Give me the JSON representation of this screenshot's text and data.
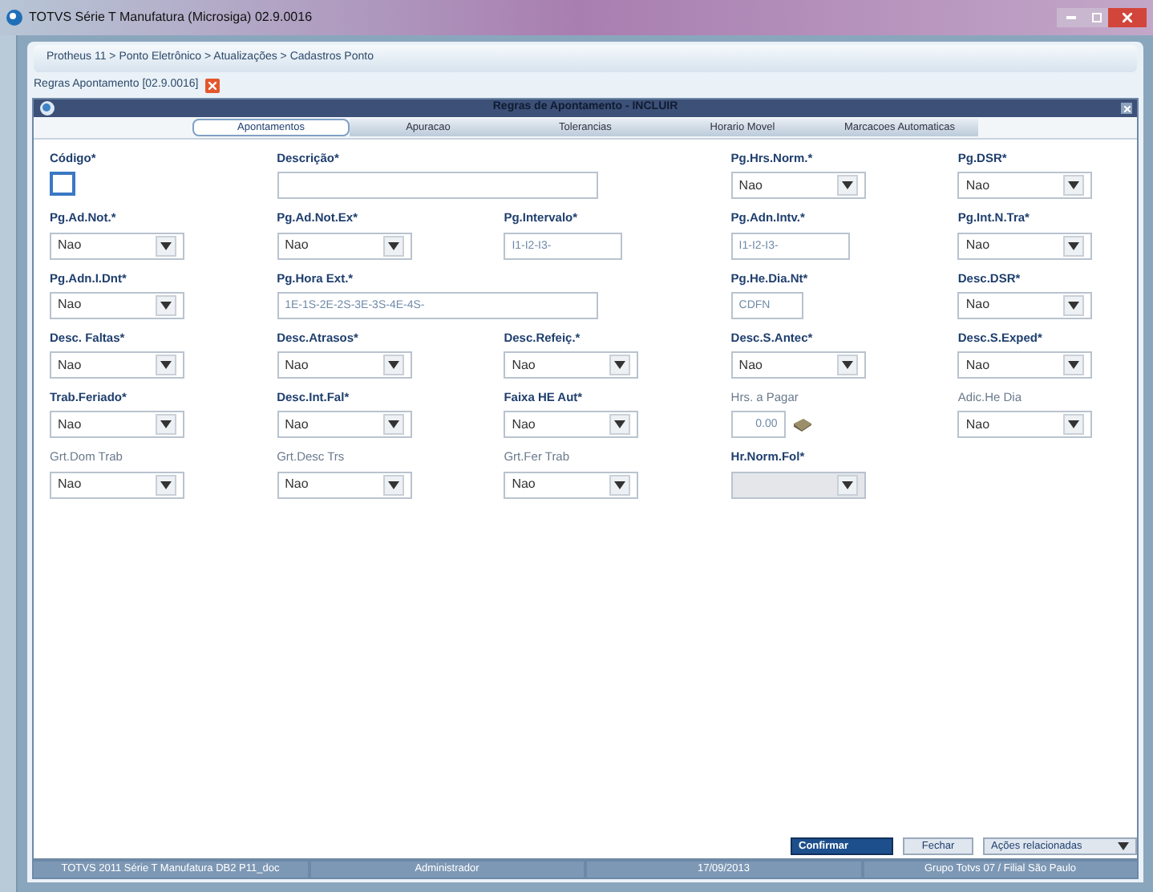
{
  "window": {
    "title": "TOTVS Série T Manufatura (Microsiga) 02.9.0016"
  },
  "breadcrumb": "Protheus 11 > Ponto Eletrônico > Atualizações > Cadastros Ponto",
  "document_tab": {
    "label": "Regras Apontamento [02.9.0016]"
  },
  "dialog": {
    "title": "Regras de Apontamento - INCLUIR"
  },
  "tabs": [
    {
      "label": "Apontamentos",
      "selected": true
    },
    {
      "label": "Apuracao",
      "selected": false
    },
    {
      "label": "Tolerancias",
      "selected": false
    },
    {
      "label": "Horario Movel",
      "selected": false
    },
    {
      "label": "Marcacoes Automaticas",
      "selected": false
    }
  ],
  "fields": [
    {
      "label": "Código*",
      "kind": "code",
      "required": true,
      "disabled": false
    },
    {
      "label": "Descrição*",
      "kind": "wide_text",
      "required": true,
      "disabled": false
    },
    {
      "label": "Pg.Hrs.Norm.*",
      "kind": "select",
      "value": "Nao",
      "required": true,
      "disabled": false
    },
    {
      "label": "Pg.DSR*",
      "kind": "select",
      "value": "Nao",
      "required": true,
      "disabled": false
    },
    {
      "label": "Pg.Ad.Not.*",
      "kind": "select",
      "value": "Nao",
      "required": true,
      "disabled": false
    },
    {
      "label": "Pg.Ad.Not.Ex*",
      "kind": "select",
      "value": "Nao",
      "required": true,
      "disabled": false
    },
    {
      "label": "Pg.Intervalo*",
      "kind": "text",
      "value": "I1-I2-I3-",
      "required": true,
      "disabled": false
    },
    {
      "label": "Pg.Adn.Intv.*",
      "kind": "text",
      "value": "I1-I2-I3-",
      "required": true,
      "disabled": false
    },
    {
      "label": "Pg.Int.N.Tra*",
      "kind": "select",
      "value": "Nao",
      "required": true,
      "disabled": false
    },
    {
      "label": "Pg.Adn.I.Dnt*",
      "kind": "select",
      "value": "Nao",
      "required": true,
      "disabled": false
    },
    {
      "label": "Pg.Hora Ext.*",
      "kind": "wide_text",
      "value": "1E-1S-2E-2S-3E-3S-4E-4S-",
      "required": true,
      "disabled": false
    },
    {
      "label": "Pg.He.Dia.Nt*",
      "kind": "short_text",
      "value": "CDFN",
      "required": true,
      "disabled": false
    },
    {
      "label": "Desc.DSR*",
      "kind": "select",
      "value": "Nao",
      "required": true,
      "disabled": false
    },
    {
      "label": "Desc. Faltas*",
      "kind": "select",
      "value": "Nao",
      "required": true,
      "disabled": false
    },
    {
      "label": "Desc.Atrasos*",
      "kind": "select",
      "value": "Nao",
      "required": true,
      "disabled": false
    },
    {
      "label": "Desc.Refeiç.*",
      "kind": "select",
      "value": "Nao",
      "required": true,
      "disabled": false
    },
    {
      "label": "Desc.S.Antec*",
      "kind": "select",
      "value": "Nao",
      "required": true,
      "disabled": false
    },
    {
      "label": "Desc.S.Exped*",
      "kind": "select",
      "value": "Nao",
      "required": true,
      "disabled": false
    },
    {
      "label": "Trab.Feriado*",
      "kind": "select",
      "value": "Nao",
      "required": true,
      "disabled": false
    },
    {
      "label": "Desc.Int.Fal*",
      "kind": "select",
      "value": "Nao",
      "required": true,
      "disabled": false
    },
    {
      "label": "Faixa HE Aut*",
      "kind": "select",
      "value": "Nao",
      "required": true,
      "disabled": false
    },
    {
      "label": "Hrs. a Pagar",
      "kind": "number",
      "value": "0.00",
      "required": false,
      "disabled": false
    },
    {
      "label": "Adic.He Dia",
      "kind": "select",
      "value": "Nao",
      "required": false,
      "disabled": false
    },
    {
      "label": "Grt.Dom Trab",
      "kind": "select",
      "value": "Nao",
      "required": false,
      "disabled": false
    },
    {
      "label": "Grt.Desc Trs",
      "kind": "select",
      "value": "Nao",
      "required": false,
      "disabled": false
    },
    {
      "label": "Grt.Fer Trab",
      "kind": "select",
      "value": "Nao",
      "required": false,
      "disabled": false
    },
    {
      "label": "Hr.Norm.Fol*",
      "kind": "select",
      "required": true,
      "disabled": true
    }
  ],
  "buttons": [
    {
      "label": "Confirmar",
      "kind": "primary"
    },
    {
      "label": "Fechar",
      "kind": "plain"
    },
    {
      "label": "Ações relacionadas",
      "kind": "menu"
    }
  ],
  "status_bar": [
    "TOTVS 2011 Série T Manufatura DB2 P11_doc",
    "Administrador",
    "17/09/2013",
    "Grupo Totvs 07 / Filial São Paulo"
  ]
}
